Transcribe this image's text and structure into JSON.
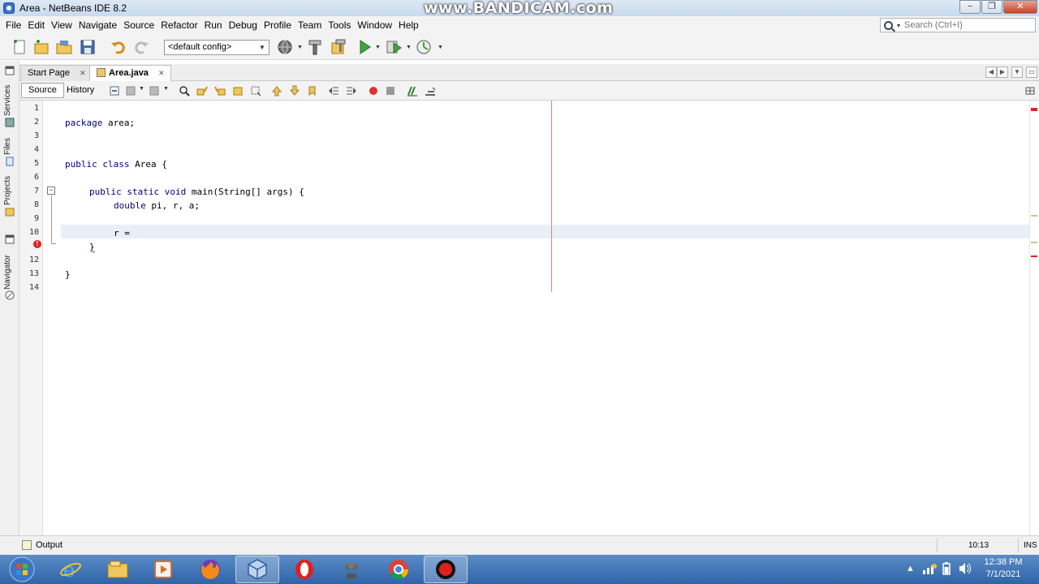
{
  "window": {
    "title": "Area - NetBeans IDE 8.2",
    "watermark": "www.BANDICAM.com",
    "controls": [
      "−",
      "❐",
      "✕"
    ]
  },
  "menu": [
    "File",
    "Edit",
    "View",
    "Navigate",
    "Source",
    "Refactor",
    "Run",
    "Debug",
    "Profile",
    "Team",
    "Tools",
    "Window",
    "Help"
  ],
  "search": {
    "placeholder": "Search (Ctrl+I)"
  },
  "toolbar": {
    "config": "<default config>"
  },
  "side_tabs": {
    "services": "Services",
    "files": "Files",
    "projects": "Projects",
    "navigator": "Navigator"
  },
  "editor_tabs": [
    {
      "label": "Start Page",
      "active": false
    },
    {
      "label": "Area.java",
      "active": true
    }
  ],
  "view_buttons": {
    "source": "Source",
    "history": "History"
  },
  "code": {
    "line_numbers": [
      "1",
      "2",
      "3",
      "4",
      "5",
      "6",
      "7",
      "8",
      "9",
      "10",
      "12",
      "13",
      "14"
    ],
    "lines": [
      {
        "kw": "",
        "text": ""
      },
      {
        "kw": "package",
        "text": " area;"
      },
      {
        "kw": "",
        "text": ""
      },
      {
        "kw": "",
        "text": ""
      },
      {
        "kw": "public class",
        "text": " Area {"
      },
      {
        "kw": "",
        "text": ""
      },
      {
        "kw": "public static void",
        "text": " main(String[] args) {"
      },
      {
        "kw": "double",
        "text": " pi, r, a;"
      },
      {
        "kw": "",
        "text": ""
      },
      {
        "kw": "",
        "text": "r ="
      },
      {
        "kw": "",
        "text": "}"
      },
      {
        "kw": "",
        "text": ""
      },
      {
        "kw": "",
        "text": "}"
      },
      {
        "kw": "",
        "text": ""
      }
    ]
  },
  "status": {
    "output": "Output",
    "position": "10:13",
    "mode": "INS"
  },
  "clock": {
    "time": "12:38 PM",
    "date": "7/1/2021"
  },
  "colors": {
    "keyword": "#000080",
    "error": "#dd2222",
    "taskbar": "#2e64a8"
  }
}
